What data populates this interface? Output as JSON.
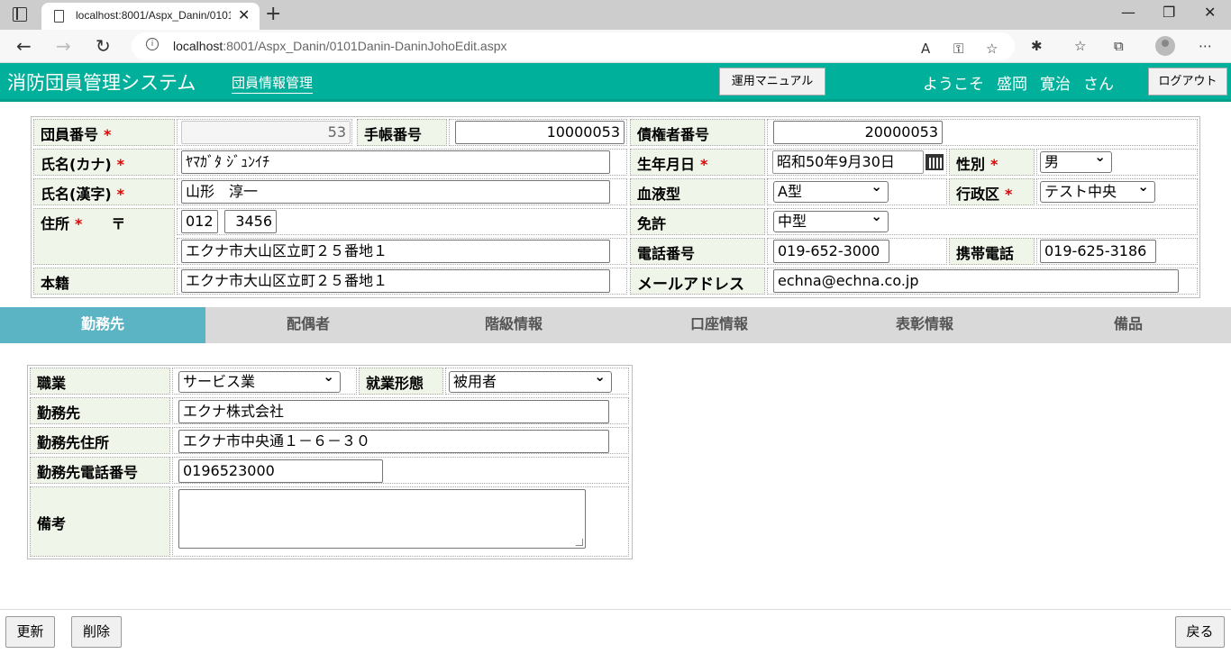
{
  "browser": {
    "tab_title": "localhost:8001/Aspx_Danin/0101",
    "tab_close": "✕",
    "new_tab": "+",
    "url_host": "localhost",
    "url_rest": ":8001/Aspx_Danin/0101Danin-DaninJohoEdit.aspx",
    "minimize": "—",
    "maximize": "❐",
    "close": "✕"
  },
  "header": {
    "app_title": "消防団員管理システム",
    "nav_link": "団員情報管理",
    "manual_button": "運用マニュアル",
    "welcome": "ようこそ",
    "user_surname": "盛岡",
    "user_given": "寛治",
    "honorific": "さん",
    "logout_button": "ログアウト"
  },
  "member": {
    "member_no_label": "団員番号",
    "member_no": "53",
    "notebook_no_label": "手帳番号",
    "notebook_no": "10000053",
    "creditor_no_label": "債権者番号",
    "creditor_no": "20000053",
    "name_kana_label": "氏名(カナ)",
    "name_kana": "ﾔﾏｶﾞﾀ ｼﾞｭﾝｲﾁ",
    "birth_label": "生年月日",
    "birth": "昭和50年9月30日",
    "gender_label": "性別",
    "gender": "男",
    "name_kanji_label": "氏名(漢字)",
    "name_kanji": "山形　淳一",
    "blood_label": "血液型",
    "blood": "A型",
    "district_label": "行政区",
    "district": "テスト中央",
    "address_label": "住所",
    "postal_mark": "〒",
    "postal_1": "012",
    "postal_2": "3456",
    "license_label": "免許",
    "license": "中型",
    "address": "エクナ市大山区立町２５番地１",
    "phone_label": "電話番号",
    "phone": "019-652-3000",
    "mobile_label": "携帯電話",
    "mobile": "019-625-3186",
    "domicile_label": "本籍",
    "domicile": "エクナ市大山区立町２５番地１",
    "email_label": "メールアドレス",
    "email": "echna@echna.co.jp",
    "required_mark": "*"
  },
  "tabs": [
    {
      "label": "勤務先",
      "active": true
    },
    {
      "label": "配偶者",
      "active": false
    },
    {
      "label": "階級情報",
      "active": false
    },
    {
      "label": "口座情報",
      "active": false
    },
    {
      "label": "表彰情報",
      "active": false
    },
    {
      "label": "備品",
      "active": false
    }
  ],
  "work": {
    "occupation_label": "職業",
    "occupation": "サービス業",
    "employment_label": "就業形態",
    "employment": "被用者",
    "workplace_label": "勤務先",
    "workplace": "エクナ株式会社",
    "work_address_label": "勤務先住所",
    "work_address": "エクナ市中央通１－６－３０",
    "work_phone_label": "勤務先電話番号",
    "work_phone": "0196523000",
    "remarks_label": "備考",
    "remarks": ""
  },
  "footer": {
    "update_button": "更新",
    "delete_button": "削除",
    "back_button": "戻る"
  },
  "colors": {
    "header_bg": "#00b09b",
    "active_tab": "#5ab4c3",
    "label_bg": "#eff5e8",
    "required": "#e00000"
  }
}
